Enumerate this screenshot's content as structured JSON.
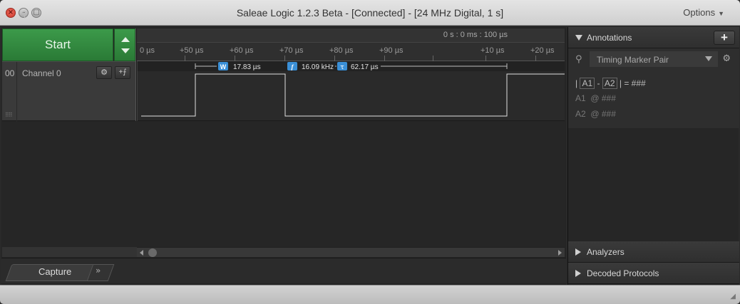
{
  "window": {
    "title": "Saleae Logic 1.2.3 Beta - [Connected] - [24 MHz Digital, 1 s]",
    "options_label": "Options"
  },
  "capture": {
    "start_label": "Start"
  },
  "timeline": {
    "timestamp": "0 s : 0 ms : 100 µs",
    "ticks": [
      "0 µs",
      "+50 µs",
      "+60 µs",
      "+70 µs",
      "+80 µs",
      "+90 µs",
      "+10 µs",
      "+20 µs"
    ]
  },
  "channels": [
    {
      "number": "00",
      "name": "Channel 0"
    }
  ],
  "measurements": {
    "width_badge": "W",
    "width_value": "17.83 µs",
    "freq_badge": "f",
    "freq_value": "16.09 kHz",
    "period_badge": "τ",
    "period_value": "62.17 µs"
  },
  "tabs": {
    "capture_label": "Capture",
    "more_label": "»"
  },
  "sidebar": {
    "annotations_label": "Annotations",
    "add_label": "+",
    "marker_type": "Timing Marker Pair",
    "diff_a1": "A1",
    "diff_sep": "-",
    "diff_a2": "A2",
    "diff_value": "= ###",
    "a1_label": "A1",
    "a1_value": "@ ###",
    "a2_label": "A2",
    "a2_value": "@ ###",
    "analyzers_label": "Analyzers",
    "decoded_label": "Decoded Protocols"
  },
  "colors": {
    "start_green": "#2f8a3c",
    "badge_blue": "#3a8fd6",
    "signal": "#e0e0e0"
  }
}
